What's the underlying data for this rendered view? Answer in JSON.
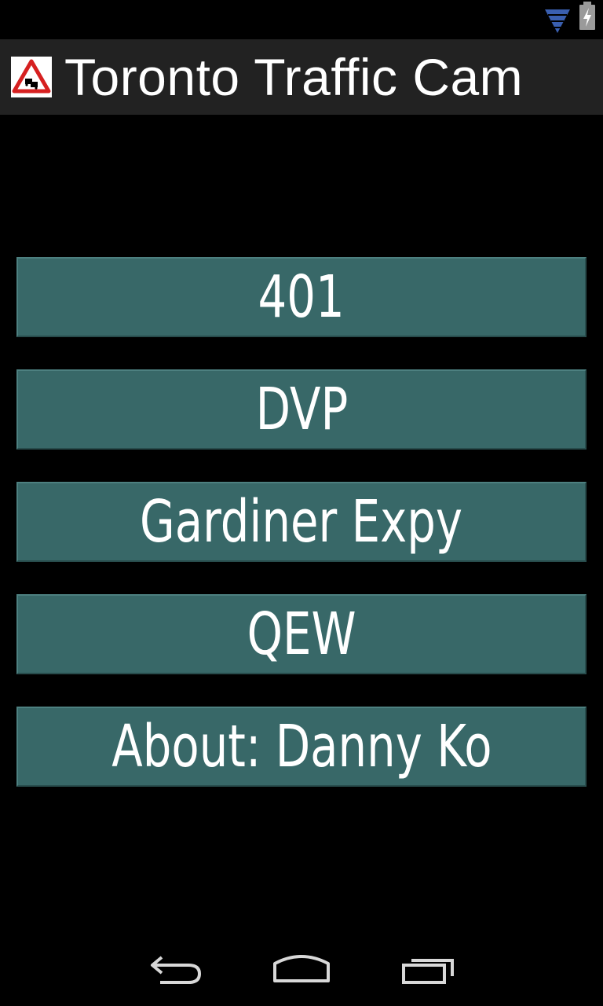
{
  "status_bar": {
    "icons": [
      "wifi-icon",
      "battery-charging-icon"
    ]
  },
  "action_bar": {
    "app_icon": "traffic-warning-icon",
    "title": "Toronto Traffic Cam"
  },
  "menu": {
    "items": [
      {
        "label": "401"
      },
      {
        "label": "DVP"
      },
      {
        "label": "Gardiner Expy"
      },
      {
        "label": "QEW"
      },
      {
        "label": "About: Danny Ko"
      }
    ]
  },
  "nav_bar": {
    "icons": [
      "back-icon",
      "home-icon",
      "recent-apps-icon"
    ]
  },
  "colors": {
    "background": "#000000",
    "action_bar": "#222222",
    "button": "#386868",
    "text": "#ffffff",
    "wifi": "#3a5fb0"
  }
}
